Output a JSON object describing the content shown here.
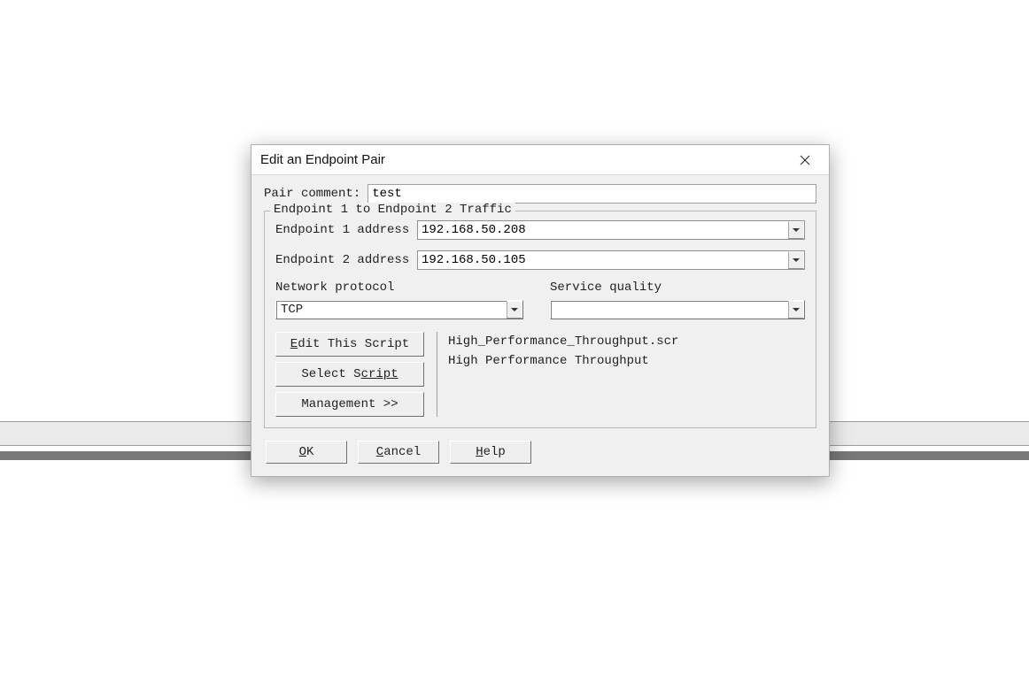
{
  "dialog": {
    "title": "Edit an Endpoint Pair",
    "pair_comment_label": "Pair comment:",
    "pair_comment_value": "test",
    "fieldset_legend": "Endpoint 1 to Endpoint 2 Traffic",
    "endpoint1_label": "Endpoint 1 address",
    "endpoint1_value": "192.168.50.208",
    "endpoint2_label": "Endpoint 2 address",
    "endpoint2_value": "192.168.50.105",
    "network_protocol_label": "Network protocol",
    "network_protocol_value": "TCP",
    "service_quality_label": "Service quality",
    "service_quality_value": "",
    "edit_script_label_pre": "E",
    "edit_script_label_post": "dit This Script",
    "select_script_label_pre": "Select S",
    "select_script_label_post": "cript",
    "management_label": "Management >>",
    "script_file": "High_Performance_Throughput.scr",
    "script_name": "High Performance Throughput",
    "ok_label_pre": "O",
    "ok_label_post": "K",
    "cancel_label_pre": "C",
    "cancel_label_post": "ancel",
    "help_label_pre": "H",
    "help_label_post": "elp"
  }
}
